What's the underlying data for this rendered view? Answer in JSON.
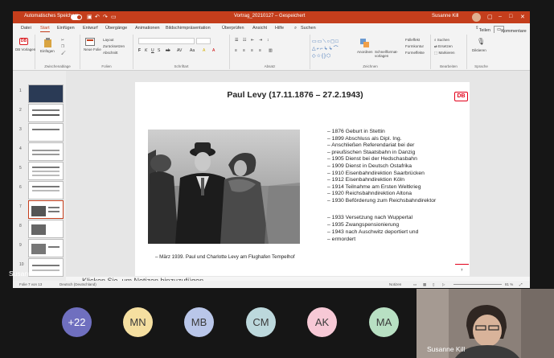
{
  "window": {
    "autosave_label": "Automatisches Speichern",
    "filename": "Vortrag_20210127 – Gespeichert",
    "user": "Susanne Kill"
  },
  "tabs": [
    "Datei",
    "Start",
    "Einfügen",
    "Entwurf",
    "Übergänge",
    "Animationen",
    "Bildschirmpräsentation",
    "Überprüfen",
    "Ansicht",
    "Hilfe"
  ],
  "active_tab": "Start",
  "search_placeholder": "Suchen",
  "share_label": "Teilen",
  "comments_label": "Kommentare",
  "ribbon": {
    "db_vorlagen": "DB Vorlagen",
    "einfuegen": "Einfügen",
    "neue_folie": "Neue Folie",
    "layout": "Layout",
    "zuruecksetzen": "Zurücksetzen",
    "abschnitt": "Abschnitt",
    "anordnen": "Anordnen",
    "schnellformatvorlagen": "Schnellformat-vorlagen",
    "fuelleffekt": "Fülleffekt",
    "formkontur": "Formkontur",
    "formeffekte": "Formeffekte",
    "suchen": "Suchen",
    "ersetzen": "Ersetzen",
    "markieren": "Markieren",
    "diktieren": "Diktieren",
    "groups": [
      "Zwischenablage",
      "Folien",
      "Schriftart",
      "Absatz",
      "Zeichnen",
      "Bearbeiten",
      "Sprache"
    ]
  },
  "slide": {
    "title": "Paul Levy (17.11.1876 – 27.2.1943)",
    "logo": "DB",
    "bio_1": [
      "1876 Geburt in Stettin",
      "1899 Abschluss als Dipl. Ing.",
      "Anschließen Referendariat bei der",
      "preußischen Staatsbahn in Danzig",
      "1905 Dienst bei der Hedschasbahn",
      "1909 Dienst in Deutsch Ostafrika",
      "1910 Eisenbahndirektion Saarbrücken",
      "1912 Eisenbahndirektion Köln",
      "1914 Teilnahme am Ersten Weltkrieg",
      "1920 Reichsbahndirektion Altona",
      "1930 Beförderung zum Reichsbahndirektor"
    ],
    "bio_2": [
      "1933 Versetzung nach Wuppertal",
      "1935 Zwangspensionierung",
      "1943 nach Auschwitz deportiert und",
      "ermordert"
    ],
    "caption": "– März 1939. Paul und Charlotte Levy am Flughafen Tempelhof",
    "page_number": "7"
  },
  "notes_placeholder": "Klicken Sie, um Notizen hinzuzufügen",
  "status": {
    "slide_info": "Folie 7 von 13",
    "language": "Deutsch (Deutschland)",
    "notes": "Notizen",
    "zoom": "81 %"
  },
  "thumbnails": [
    "1",
    "2",
    "3",
    "4",
    "5",
    "6",
    "7",
    "8",
    "9",
    "10"
  ],
  "active_thumbnail": 6,
  "speaker_name": "Susanne Kill",
  "participants": [
    {
      "label": "+22",
      "color": "#6f6fbf"
    },
    {
      "label": "MN",
      "color": "#f5dfa0"
    },
    {
      "label": "MB",
      "color": "#b9c6e9"
    },
    {
      "label": "CM",
      "color": "#bcd8dc"
    },
    {
      "label": "AK",
      "color": "#f7c9d6"
    },
    {
      "label": "MA",
      "color": "#b8e0c3"
    }
  ],
  "self_video_name": "Susanne Kill"
}
